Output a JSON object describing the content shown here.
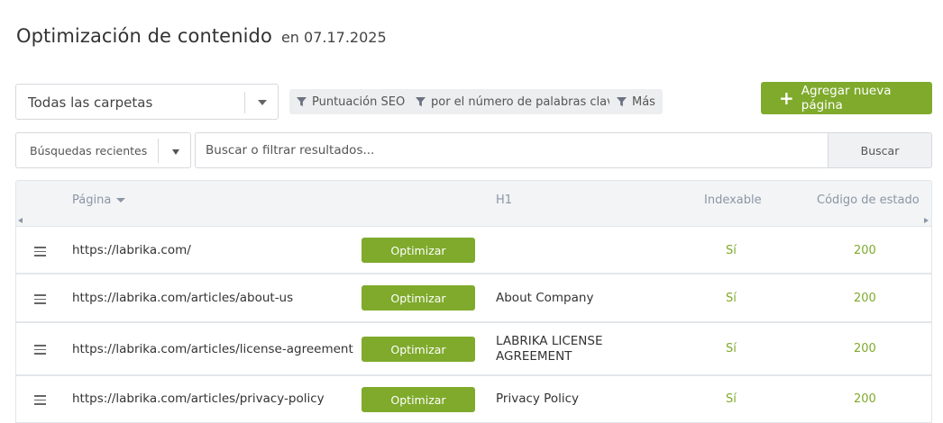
{
  "header": {
    "title": "Optimización de contenido",
    "date": "en 07.17.2025"
  },
  "filters": {
    "folder_select": "Todas las carpetas",
    "chips": [
      "Puntuación SEO",
      "por el número de palabras clave",
      "Más"
    ],
    "add_button": "Agregar nueva página"
  },
  "search": {
    "recent": "Búsquedas recientes",
    "placeholder": "Buscar o filtrar resultados...",
    "button": "Buscar"
  },
  "table": {
    "columns": {
      "page": "Página",
      "h1": "H1",
      "indexable": "Indexable",
      "status": "Código de estado"
    },
    "optimize_label": "Optimizar",
    "rows": [
      {
        "url": "https://labrika.com/",
        "h1": "",
        "indexable": "Sí",
        "status": "200"
      },
      {
        "url": "https://labrika.com/articles/about-us",
        "h1": "About Company",
        "indexable": "Sí",
        "status": "200"
      },
      {
        "url": "https://labrika.com/articles/license-agreement",
        "h1": "LABRIKA LICENSE AGREEMENT",
        "indexable": "Sí",
        "status": "200"
      },
      {
        "url": "https://labrika.com/articles/privacy-policy",
        "h1": "Privacy Policy",
        "indexable": "Sí",
        "status": "200"
      }
    ]
  },
  "colors": {
    "accent": "#7faa2c"
  }
}
